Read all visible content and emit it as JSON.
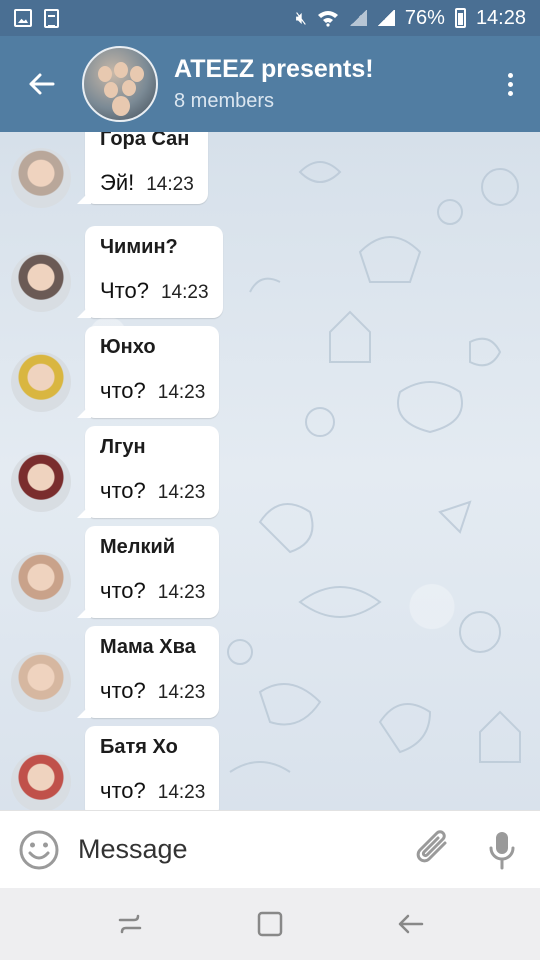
{
  "status_bar": {
    "battery": "76%",
    "time": "14:28"
  },
  "header": {
    "title": "ATEEZ presents!",
    "subtitle": "8 members"
  },
  "messages": [
    {
      "sender": "Гора Сан",
      "text": "Эй!",
      "time": "14:23",
      "avatar_color": "#b9a79a"
    },
    {
      "sender": "Чимин?",
      "text": "Что?",
      "time": "14:23",
      "avatar_color": "#6b5a55"
    },
    {
      "sender": "Юнхо",
      "text": "что?",
      "time": "14:23",
      "avatar_color": "#d9b640"
    },
    {
      "sender": "Лгун",
      "text": "что?",
      "time": "14:23",
      "avatar_color": "#7a2d2d"
    },
    {
      "sender": "Мелкий",
      "text": "что?",
      "time": "14:23",
      "avatar_color": "#c9a28a"
    },
    {
      "sender": "Мама Хва",
      "text": "что?",
      "time": "14:23",
      "avatar_color": "#d6b7a0"
    },
    {
      "sender": "Батя Хо",
      "text": "что?",
      "time": "14:23",
      "avatar_color": "#c0514a"
    }
  ],
  "input": {
    "placeholder": "Message"
  },
  "colors": {
    "header": "#517da2",
    "status_bar": "#4a6f93",
    "bubble": "#ffffff",
    "input_icons": "#9a9a9a"
  },
  "icons": {
    "back": "arrow-left-icon",
    "menu": "more-vertical-icon",
    "emoji": "smiley-icon",
    "attach": "paperclip-icon",
    "mic": "microphone-icon"
  }
}
